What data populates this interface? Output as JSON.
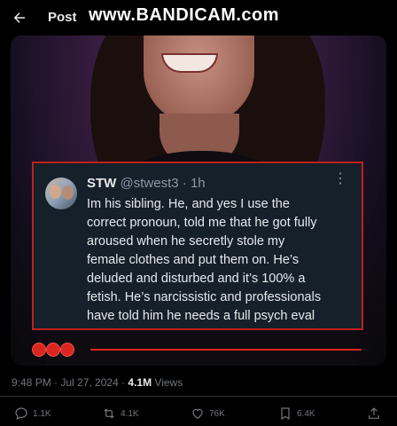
{
  "header": {
    "title": "Post"
  },
  "watermark": "www.BANDICAM.com",
  "embedded_tweet": {
    "name": "STW",
    "handle": "@stwest3",
    "separator": "·",
    "time": "1h",
    "more": "⋮",
    "lines": [
      "Im his sibling. He, and yes I use the",
      "correct pronoun, told me that he got fully",
      "aroused when he secretly stole my",
      "female clothes and put them on. He’s",
      "deluded and disturbed and it’s 100% a",
      "fetish. He’s narcissistic and professionals",
      "have told him he needs a full psych eval"
    ]
  },
  "meta": {
    "timestamp": "9:48 PM · Jul 27, 2024 · ",
    "views_count": "4.1M",
    "views_label": " Views"
  },
  "actions": {
    "reply_count": "1.1K",
    "repost_count": "4.1K",
    "like_count": "76K",
    "bookmark_count": "6.4K"
  },
  "icons": [
    "back-arrow-icon",
    "chat-bubble-icon",
    "repost-icon",
    "heart-icon",
    "bookmark-icon",
    "share-icon"
  ],
  "colors": {
    "accent_red": "#d9261f",
    "muted": "#71767b",
    "text": "#e7e9ea"
  }
}
